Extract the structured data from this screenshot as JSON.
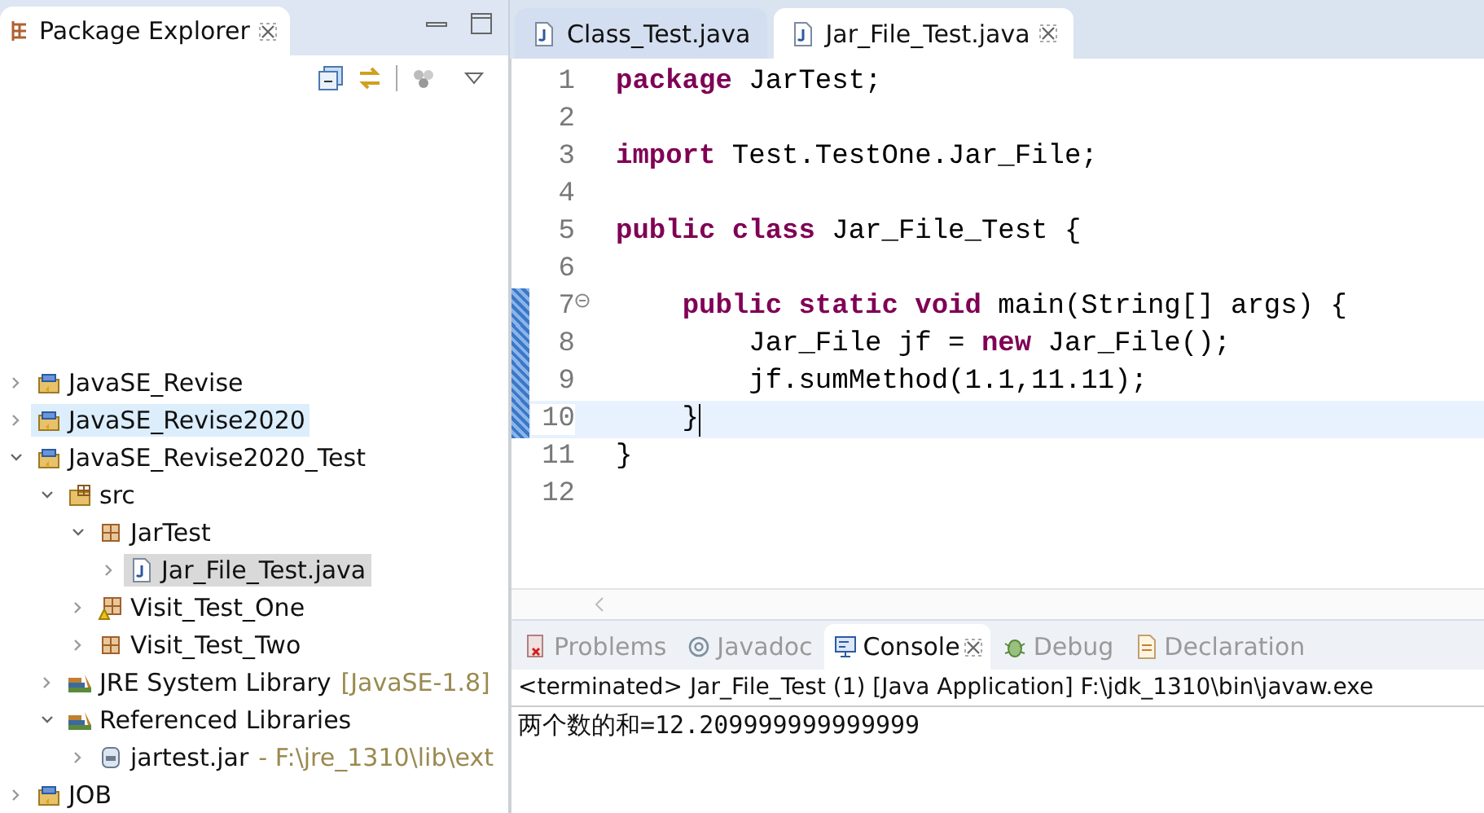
{
  "package_explorer": {
    "tab": {
      "label": "Package Explorer",
      "selected": true
    },
    "tree": [
      {
        "label": "JavaSE_Revise",
        "kind": "project",
        "expanded": false,
        "selected": false,
        "hover": false
      },
      {
        "label": "JavaSE_Revise2020",
        "kind": "project",
        "expanded": false,
        "selected": false,
        "hover": true
      },
      {
        "label": "JavaSE_Revise2020_Test",
        "kind": "project",
        "expanded": true,
        "selected": false,
        "hover": false,
        "children": [
          {
            "label": "src",
            "kind": "source-folder",
            "expanded": true,
            "selected": false,
            "hover": false,
            "children": [
              {
                "label": "JarTest",
                "kind": "package",
                "expanded": true,
                "selected": false,
                "hover": false,
                "children": [
                  {
                    "label": "Jar_File_Test.java",
                    "kind": "java-file",
                    "expanded": false,
                    "selected": true,
                    "hover": false
                  }
                ]
              },
              {
                "label": "Visit_Test_One",
                "kind": "package-warning",
                "expanded": false,
                "selected": false,
                "hover": false
              },
              {
                "label": "Visit_Test_Two",
                "kind": "package",
                "expanded": false,
                "selected": false,
                "hover": false
              }
            ]
          },
          {
            "label": "JRE System Library",
            "decoration": "[JavaSE-1.8]",
            "kind": "library",
            "expanded": false,
            "selected": false,
            "hover": false
          },
          {
            "label": "Referenced Libraries",
            "kind": "library",
            "expanded": true,
            "selected": false,
            "hover": false,
            "children": [
              {
                "label": "jartest.jar",
                "decoration": "- F:\\jre_1310\\lib\\ext",
                "kind": "jar",
                "expanded": false,
                "selected": false,
                "hover": false
              }
            ]
          }
        ]
      },
      {
        "label": "JOB",
        "kind": "project",
        "expanded": false,
        "selected": false,
        "hover": false
      }
    ]
  },
  "editor": {
    "tabs": [
      {
        "label": "Class_Test.java",
        "selected": false
      },
      {
        "label": "Jar_File_Test.java",
        "selected": true
      }
    ],
    "lines": [
      {
        "number": "1",
        "text": "**package** JarTest;",
        "changed": false,
        "current": false,
        "fold": false
      },
      {
        "number": "2",
        "changed": false,
        "current": false,
        "fold": false
      },
      {
        "number": "3",
        "text": "**import** Test.TestOne.Jar_File;",
        "changed": false,
        "current": false,
        "fold": false
      },
      {
        "number": "4",
        "changed": false,
        "current": false,
        "fold": false
      },
      {
        "number": "5",
        "text": "**public** **class** Jar_File_Test {",
        "changed": false,
        "current": false,
        "fold": false
      },
      {
        "number": "6",
        "changed": false,
        "current": false,
        "fold": false
      },
      {
        "number": "7",
        "text": "    **public** **static** **void** main(String[] args) {",
        "changed": true,
        "current": false,
        "fold": true
      },
      {
        "number": "8",
        "text": "        Jar_File jf = **new** Jar_File();",
        "changed": true,
        "current": false,
        "fold": false
      },
      {
        "number": "9",
        "text": "        jf.sumMethod(1.1,11.11);",
        "changed": true,
        "current": false,
        "fold": false
      },
      {
        "number": "10",
        "text": "    }",
        "changed": true,
        "current": true,
        "fold": false
      },
      {
        "number": "11",
        "text": "}",
        "changed": false,
        "current": false,
        "fold": false
      },
      {
        "number": "12",
        "changed": false,
        "current": false,
        "fold": false
      }
    ]
  },
  "bottom_panel": {
    "tabs": [
      {
        "label": "Problems",
        "kind": "problems",
        "selected": false
      },
      {
        "label": "Javadoc",
        "kind": "javadoc",
        "selected": false
      },
      {
        "label": "Console",
        "kind": "console",
        "selected": true
      },
      {
        "label": "Debug",
        "kind": "debug",
        "selected": false
      },
      {
        "label": "Declaration",
        "kind": "declaration",
        "selected": false
      }
    ],
    "console": {
      "status": "<terminated> Jar_File_Test (1) [Java Application] F:\\jdk_1310\\bin\\javaw.exe",
      "output": [
        "两个数的和=12.209999999999999"
      ]
    }
  }
}
